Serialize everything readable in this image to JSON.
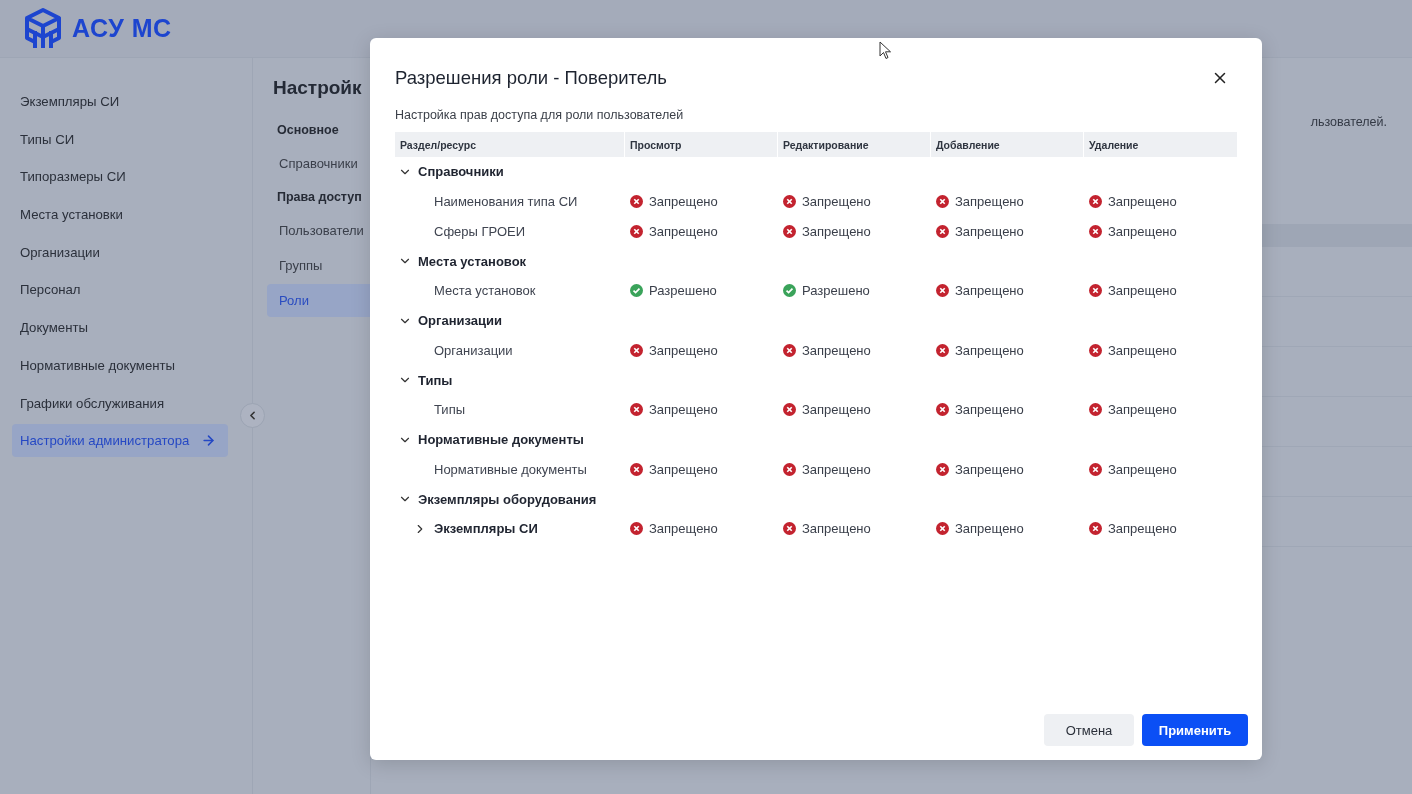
{
  "app": {
    "logo": "АСУ МС"
  },
  "sidebar": {
    "items": [
      {
        "label": "Экземпляры СИ",
        "selected": false
      },
      {
        "label": "Типы СИ",
        "selected": false
      },
      {
        "label": "Типоразмеры СИ",
        "selected": false
      },
      {
        "label": "Места установки",
        "selected": false
      },
      {
        "label": "Организации",
        "selected": false
      },
      {
        "label": "Персонал",
        "selected": false
      },
      {
        "label": "Документы",
        "selected": false
      },
      {
        "label": "Нормативные документы",
        "selected": false
      },
      {
        "label": "Графики обслуживания",
        "selected": false
      },
      {
        "label": "Настройки администратора",
        "selected": true
      }
    ]
  },
  "settings_nav": {
    "title": "Настройк",
    "sections": [
      {
        "heading": "Основное",
        "items": [
          {
            "label": "Справочники",
            "selected": false
          }
        ]
      },
      {
        "heading": "Права доступ",
        "items": [
          {
            "label": "Пользователи",
            "selected": false
          },
          {
            "label": "Группы",
            "selected": false
          },
          {
            "label": "Роли",
            "selected": true
          }
        ]
      }
    ]
  },
  "background_description": "льзователей.",
  "dialog": {
    "title": "Разрешения роли - Поверитель",
    "subtitle": "Настройка прав доступа для роли пользователей",
    "columns": [
      "Раздел/ресурс",
      "Просмотр",
      "Редактирование",
      "Добавление",
      "Удаление"
    ],
    "groups": [
      {
        "label": "Справочники",
        "expanded": true,
        "children": [
          {
            "label": "Наименования типа СИ",
            "kind": "leaf",
            "permissions": [
              {
                "kind": "denied",
                "text": "Запрещено"
              },
              {
                "kind": "denied",
                "text": "Запрещено"
              },
              {
                "kind": "denied",
                "text": "Запрещено"
              },
              {
                "kind": "denied",
                "text": "Запрещено"
              }
            ]
          },
          {
            "label": "Сферы ГРОЕИ",
            "kind": "leaf",
            "permissions": [
              {
                "kind": "denied",
                "text": "Запрещено"
              },
              {
                "kind": "denied",
                "text": "Запрещено"
              },
              {
                "kind": "denied",
                "text": "Запрещено"
              },
              {
                "kind": "denied",
                "text": "Запрещено"
              }
            ]
          }
        ]
      },
      {
        "label": "Места установок",
        "expanded": true,
        "children": [
          {
            "label": "Места установок",
            "kind": "leaf",
            "permissions": [
              {
                "kind": "allowed",
                "text": "Разрешено"
              },
              {
                "kind": "allowed",
                "text": "Разрешено"
              },
              {
                "kind": "denied",
                "text": "Запрещено"
              },
              {
                "kind": "denied",
                "text": "Запрещено"
              }
            ]
          }
        ]
      },
      {
        "label": "Организации",
        "expanded": true,
        "children": [
          {
            "label": "Организации",
            "kind": "leaf",
            "permissions": [
              {
                "kind": "denied",
                "text": "Запрещено"
              },
              {
                "kind": "denied",
                "text": "Запрещено"
              },
              {
                "kind": "denied",
                "text": "Запрещено"
              },
              {
                "kind": "denied",
                "text": "Запрещено"
              }
            ]
          }
        ]
      },
      {
        "label": "Типы",
        "expanded": true,
        "children": [
          {
            "label": "Типы",
            "kind": "leaf",
            "permissions": [
              {
                "kind": "denied",
                "text": "Запрещено"
              },
              {
                "kind": "denied",
                "text": "Запрещено"
              },
              {
                "kind": "denied",
                "text": "Запрещено"
              },
              {
                "kind": "denied",
                "text": "Запрещено"
              }
            ]
          }
        ]
      },
      {
        "label": "Нормативные документы",
        "expanded": true,
        "children": [
          {
            "label": "Нормативные документы",
            "kind": "leaf",
            "permissions": [
              {
                "kind": "denied",
                "text": "Запрещено"
              },
              {
                "kind": "denied",
                "text": "Запрещено"
              },
              {
                "kind": "denied",
                "text": "Запрещено"
              },
              {
                "kind": "denied",
                "text": "Запрещено"
              }
            ]
          }
        ]
      },
      {
        "label": "Экземпляры оборудования",
        "expanded": true,
        "children": [
          {
            "label": "Экземпляры СИ",
            "kind": "folder",
            "expanded": false,
            "permissions": [
              {
                "kind": "denied",
                "text": "Запрещено"
              },
              {
                "kind": "denied",
                "text": "Запрещено"
              },
              {
                "kind": "denied",
                "text": "Запрещено"
              },
              {
                "kind": "denied",
                "text": "Запрещено"
              }
            ]
          }
        ]
      }
    ],
    "buttons": [
      {
        "label": "Отмена",
        "kind": "secondary"
      },
      {
        "label": "Применить",
        "kind": "primary"
      }
    ]
  }
}
